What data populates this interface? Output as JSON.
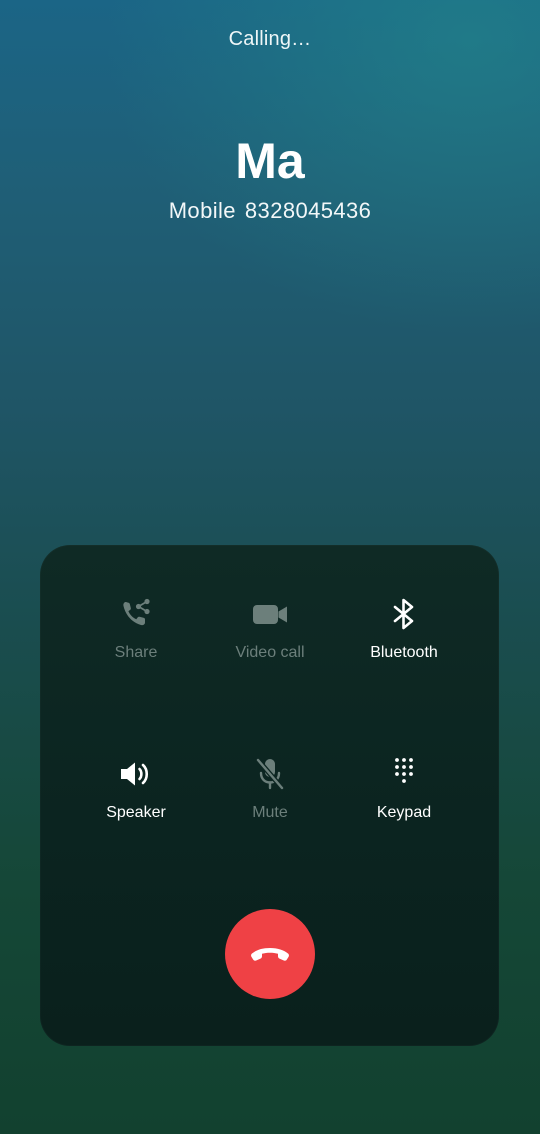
{
  "call": {
    "status": "Calling…",
    "contact_name": "Ma",
    "number_type": "Mobile",
    "number": "8328045436"
  },
  "controls": [
    {
      "label": "Share",
      "icon": "share-call-icon",
      "enabled": false
    },
    {
      "label": "Video call",
      "icon": "video-camera-icon",
      "enabled": false
    },
    {
      "label": "Bluetooth",
      "icon": "bluetooth-icon",
      "enabled": true
    },
    {
      "label": "Speaker",
      "icon": "speaker-icon",
      "enabled": true
    },
    {
      "label": "Mute",
      "icon": "mic-off-icon",
      "enabled": false
    },
    {
      "label": "Keypad",
      "icon": "dialpad-icon",
      "enabled": true
    }
  ],
  "end_call": {
    "icon": "end-call-icon",
    "color": "#ef4145"
  },
  "colors": {
    "disabled": "#6c7f7b",
    "enabled": "#ffffff"
  }
}
